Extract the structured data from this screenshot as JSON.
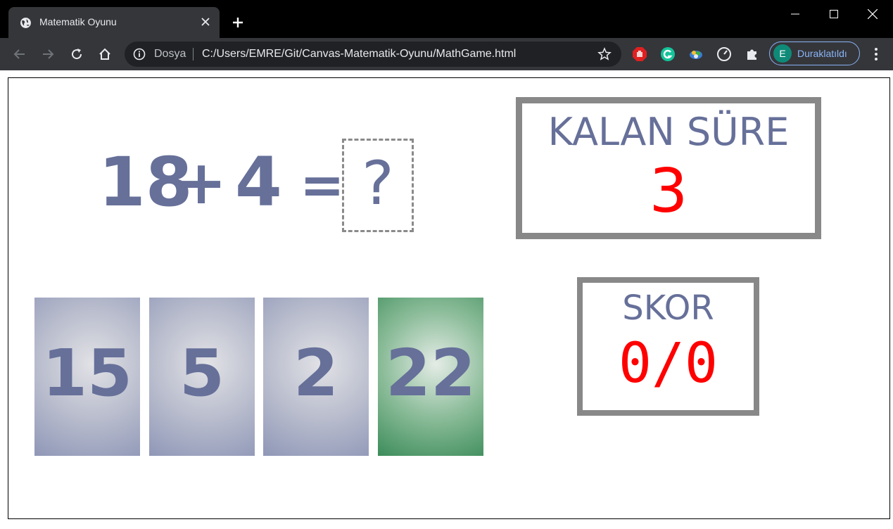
{
  "browser": {
    "tab_title": "Matematik Oyunu",
    "omnibox": {
      "scheme_label": "Dosya",
      "url": "C:/Users/EMRE/Git/Canvas-Matematik-Oyunu/MathGame.html"
    },
    "profile": {
      "initial": "E",
      "status": "Duraklatıldı"
    }
  },
  "game": {
    "equation": {
      "left": "18",
      "operator": "+",
      "right": "4",
      "equals": "=",
      "answer_placeholder": "?"
    },
    "timer": {
      "label": "KALAN SÜRE",
      "value": "3"
    },
    "score": {
      "label": "SKOR",
      "value": "0/0"
    },
    "cards": [
      {
        "value": "15",
        "state": "default"
      },
      {
        "value": "5",
        "state": "default"
      },
      {
        "value": "2",
        "state": "default"
      },
      {
        "value": "22",
        "state": "correct"
      }
    ]
  },
  "colors": {
    "text_primary": "#667099",
    "accent_red": "#ff0000",
    "box_border": "#888888",
    "card_correct": "#3c8c5a"
  }
}
